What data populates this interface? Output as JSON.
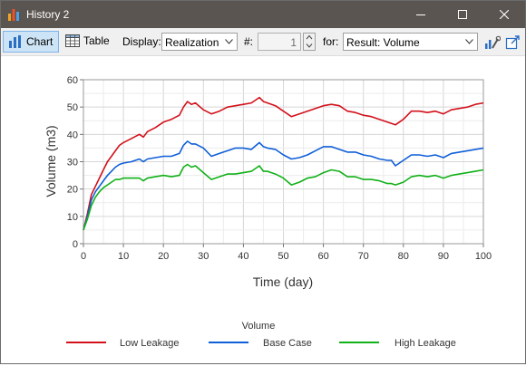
{
  "window": {
    "title": "History 2"
  },
  "toolbar": {
    "chart_label": "Chart",
    "table_label": "Table",
    "display_label": "Display:",
    "display_value": "Realization",
    "number_label": "#:",
    "number_value": "1",
    "for_label": "for:",
    "for_value": "Result: Volume"
  },
  "colors": {
    "titlebar": "#5b5551",
    "low_leakage": "#d2111b",
    "base_case": "#0f5fd7",
    "high_leakage": "#11b118"
  },
  "chart_data": {
    "type": "line",
    "xlabel": "Time (day)",
    "ylabel": "Volume (m3)",
    "xlim": [
      0,
      100
    ],
    "ylim": [
      0,
      60
    ],
    "xticks": [
      0,
      10,
      20,
      30,
      40,
      50,
      60,
      70,
      80,
      90,
      100
    ],
    "yticks": [
      0,
      10,
      20,
      30,
      40,
      50,
      60
    ],
    "grid": true,
    "legend_title": "Volume",
    "legend_position": "bottom",
    "x": [
      0,
      1,
      2,
      3,
      4,
      5,
      6,
      7,
      8,
      9,
      10,
      12,
      14,
      15,
      16,
      18,
      20,
      22,
      24,
      25,
      26,
      27,
      28,
      30,
      32,
      34,
      36,
      38,
      40,
      42,
      44,
      45,
      46,
      48,
      50,
      52,
      54,
      56,
      58,
      60,
      62,
      64,
      66,
      68,
      70,
      72,
      74,
      76,
      77,
      78,
      80,
      82,
      84,
      86,
      88,
      90,
      92,
      94,
      96,
      98,
      100
    ],
    "series": [
      {
        "name": "Low Leakage",
        "values": [
          5,
          11,
          18,
          21,
          24,
          27,
          30,
          32,
          34,
          36,
          37,
          38.5,
          40,
          39,
          41,
          42.5,
          44.5,
          45.5,
          47,
          50,
          52,
          51,
          51.5,
          49,
          47.5,
          48.5,
          50,
          50.5,
          51,
          51.5,
          53.5,
          52,
          51.5,
          50.5,
          48.5,
          46.5,
          47.5,
          48.5,
          49.5,
          50.5,
          51,
          50.5,
          48.5,
          48,
          47,
          46.5,
          45.5,
          44.5,
          44,
          43.5,
          45.5,
          48.5,
          48.5,
          48,
          48.5,
          47.5,
          49,
          49.5,
          50,
          51,
          51.5
        ]
      },
      {
        "name": "Base Case",
        "values": [
          5,
          10,
          16,
          19,
          21,
          23,
          25,
          26.5,
          28,
          29,
          29.5,
          30,
          31,
          30,
          31,
          31.5,
          32,
          32,
          33,
          36,
          37.5,
          36.5,
          36.5,
          35,
          32,
          33,
          34,
          35,
          35,
          34.5,
          37,
          35.5,
          35,
          34.5,
          32.5,
          31,
          31.5,
          32.5,
          34,
          35.5,
          35.5,
          34.5,
          33.5,
          33.5,
          32.5,
          32,
          31,
          30.5,
          30.5,
          28.5,
          30.5,
          32.5,
          32.5,
          32,
          32.5,
          31.5,
          33,
          33.5,
          34,
          34.5,
          35
        ]
      },
      {
        "name": "High Leakage",
        "values": [
          5,
          9,
          14,
          17,
          19,
          20.5,
          21.5,
          22.5,
          23.5,
          23.5,
          24,
          24,
          24,
          23,
          24,
          24.5,
          25,
          24.5,
          25,
          28,
          29,
          28,
          28.5,
          26,
          23.5,
          24.5,
          25.5,
          25.5,
          26,
          26.5,
          28.5,
          26.5,
          26.5,
          25.5,
          24,
          21.5,
          22.5,
          24,
          24.5,
          26,
          27,
          26.5,
          24.5,
          24.5,
          23.5,
          23.5,
          23,
          22,
          22,
          21.5,
          22.5,
          24.5,
          25,
          24.5,
          25,
          24,
          25,
          25.5,
          26,
          26.5,
          27
        ]
      }
    ]
  }
}
